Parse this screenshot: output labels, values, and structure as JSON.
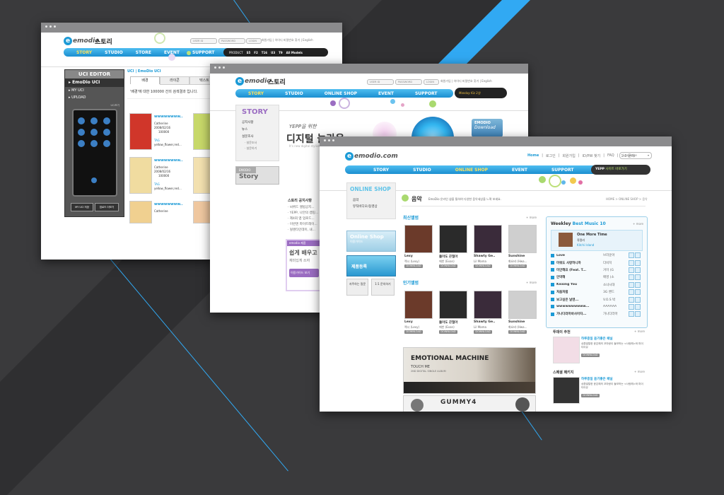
{
  "brand": {
    "logo_text": "emodio",
    "logo_com": "emodio.com",
    "story_word": "스토리"
  },
  "colors": {
    "background": "#3a3a3c",
    "accent_blue": "#1b9ad6",
    "stripe_blue": "#31a9f3",
    "nav_yellow": "#ffe25a",
    "purple": "#9b6dc2"
  },
  "window1": {
    "login": {
      "userid": "USER ID",
      "password": "PASSWORD",
      "login_btn": "LOGIN",
      "links": "회원가입 | 아이디 비밀번호 찾기 | English"
    },
    "nav": [
      "STORY",
      "STUDIO",
      "STORE",
      "EVENT",
      "SUPPORT"
    ],
    "product": {
      "label": "PRODUCT",
      "models": [
        "S5",
        "F2",
        "T16",
        "U3",
        "T9"
      ],
      "all": "All Models"
    },
    "uci_editor": {
      "title": "UCI EDITOR",
      "items": [
        "EmoDio UCI",
        "MY UCI",
        "UPLOAD"
      ],
      "device_caption": "UCI보기",
      "btn_my": "MY UCI 저장",
      "btn_upload": "업로드 더보기"
    },
    "breadcrumb": "UCI | EmoDio UCI",
    "tabs": [
      "배경",
      "라이콘",
      "텍스트"
    ],
    "result_text": "'배경'에 대한 100000 건의 검색결과 입니다.",
    "items": [
      {
        "title": "wwwwwwww..",
        "author": "Catherine",
        "date": "2008/02/16",
        "count": "100000",
        "tag": "TAG",
        "file": "yellow_flower,red..."
      },
      {
        "title": "wwwwwwww..",
        "author": "Catherine",
        "date": "2008/02/16",
        "count": "100000",
        "tag": "TAG",
        "file": "yellow_flower,red..."
      },
      {
        "title": "wwwwwwww..",
        "author": "Catherine",
        "date": "2008/02/16",
        "count": "100000",
        "tag": "TAG",
        "file": "yellow_flower,red..."
      },
      {
        "title": "wwwwwwww..",
        "author": "Catherine",
        "date": "2008/02/16",
        "count": "100000",
        "tag": "TAG",
        "file": "yellow_flower,red..."
      },
      {
        "title": "wwwwwwww..",
        "author": "Catherine",
        "date": "",
        "count": "",
        "tag": "",
        "file": ""
      }
    ]
  },
  "window2": {
    "login": {
      "userid": "USER ID",
      "password": "PASSWORD",
      "login_btn": "LOGIN",
      "links": "회원가입 | 아이디 비밀번호 찾기 | English"
    },
    "nav": [
      "STORY",
      "STUDIO",
      "ONLINE SHOP",
      "EVENT",
      "SUPPORT"
    ],
    "banner": "Monday Kiz 3집",
    "side_title": "STORY",
    "side_menu": [
      "공지사항",
      "뉴스",
      "설문조사"
    ],
    "side_sub": [
      "· 설문조사",
      "· 설문하기"
    ],
    "story_btn": "Story",
    "story_btn_top": "EMODIO",
    "hero_small": "YEPP을 위한",
    "hero_big": "디지털 놀라움",
    "hero_sub": "It's new digital stylish Speaker 'EmoDio'",
    "download_top": "EMODIO",
    "download_label": "Download",
    "notice_title": "스토리 공지사항",
    "notice_items": [
      "· 씨쒸드 앨범공지...",
      "· YEPP, 나만의 캠핑...",
      "· 제4회 앱 업로드...",
      "· 이번엔 파이트레이...",
      "· 될렌타인데이, 내..."
    ],
    "promo_label": "emodio 제품",
    "promo_line1": "쉽게 배우고",
    "promo_line2": "재미있게 쓰자",
    "promo_btn": "이용가이드 보기"
  },
  "window3": {
    "toplinks": [
      "Home",
      "로그인",
      "회원가입",
      "ID/PW 찾기",
      "FAQ",
      "1:1 문의"
    ],
    "language": "Language",
    "nav": [
      "STORY",
      "STUDIO",
      "ONLINE SHOP",
      "EVENT",
      "SUPPORT"
    ],
    "yepp_banner": "YEPP",
    "yepp_text": "사이트 바로가기",
    "side_title": "ONLINE SHOP",
    "side_menu": [
      "음악",
      "뮤직비디오/동영상"
    ],
    "side_btn1_title": "Online Shop",
    "side_btn1_sub": "이용가이드",
    "side_btn2": "제품등록",
    "side_small1": "자주하는 질문",
    "side_small2": "1:1 문의하기",
    "page_title": "음악",
    "page_desc": "EmoDio 온라인 샵을 통하여 다양한 음악세상을 느껴 보세요.",
    "breadcrumb": "HOME > ONLINE SHOP > 음악",
    "latest_title": "최신앨범",
    "popular_title": "인기앨범",
    "more": "+ more",
    "download_btn": "DOWNLOAD",
    "latest": [
      {
        "name": "Lexy",
        "artist": "렉시 (Lexy)"
      },
      {
        "name": "돌아도 끈질아",
        "artist": "에반 (Evan)"
      },
      {
        "name": "Shawty Ge..",
        "artist": "Lil Mama"
      },
      {
        "name": "Sunshine",
        "artist": "화요비 (Hwa..."
      }
    ],
    "popular": [
      {
        "name": "Lexy",
        "artist": "렉시 (Lexy)"
      },
      {
        "name": "돌아도 끈질아",
        "artist": "에반 (Evan)"
      },
      {
        "name": "Shawty Ge..",
        "artist": "Lil Mama"
      },
      {
        "name": "Sunshine",
        "artist": "화요비 (Hwa..."
      }
    ],
    "banner_title": "EMOTIONAL MACHINE",
    "banner_sub1": "TOUCH ME",
    "banner_sub2": "2ND DIGITAL SINGLE ALBUM",
    "banner2_title": "GUMMY4",
    "weekly": {
      "title_a": "Weekley",
      "title_b": "Best Music",
      "title_num": "10",
      "top": {
        "title": "One More Time",
        "artist": "쥬얼리",
        "album": "Kitchi Island"
      },
      "list": [
        {
          "num": "2",
          "title": "Love",
          "artist": "브라운아"
        },
        {
          "num": "3",
          "title": "미워도 사랑하니까",
          "artist": "다비치"
        },
        {
          "num": "4",
          "title": "미안해요 (Feat. T...",
          "artist": "거미 (G"
        },
        {
          "num": "5",
          "title": "안약해",
          "artist": "매영 (소"
        },
        {
          "num": "6",
          "title": "Kissing You",
          "artist": "소녀시대"
        },
        {
          "num": "7",
          "title": "처음처럼",
          "artist": "3G 밴드"
        },
        {
          "num": "8",
          "title": "보고싶은 날엔...",
          "artist": "V.O.S 박"
        },
        {
          "num": "9",
          "title": "wwwwwwwwww...",
          "artist": "AAAAAA"
        },
        {
          "num": "10",
          "title": "가나다라마바사아자...",
          "artist": "가나다라마"
        }
      ]
    },
    "recommend": {
      "title": "투데이 추천",
      "heading": "하루종일 듣기좋은 패닐",
      "body": "상큼발랄한 윤은혜의 꼬마랑이 돌보하는 <사랑해>와 파이티아유"
    },
    "package": {
      "title": "스페셜 패키지",
      "heading": "하루종일 듣기좋은 패닐",
      "body": "상큼발랄한 윤은혜의 꼬마랑이 돌보하는 <사랑해>와 파이티아유"
    }
  }
}
